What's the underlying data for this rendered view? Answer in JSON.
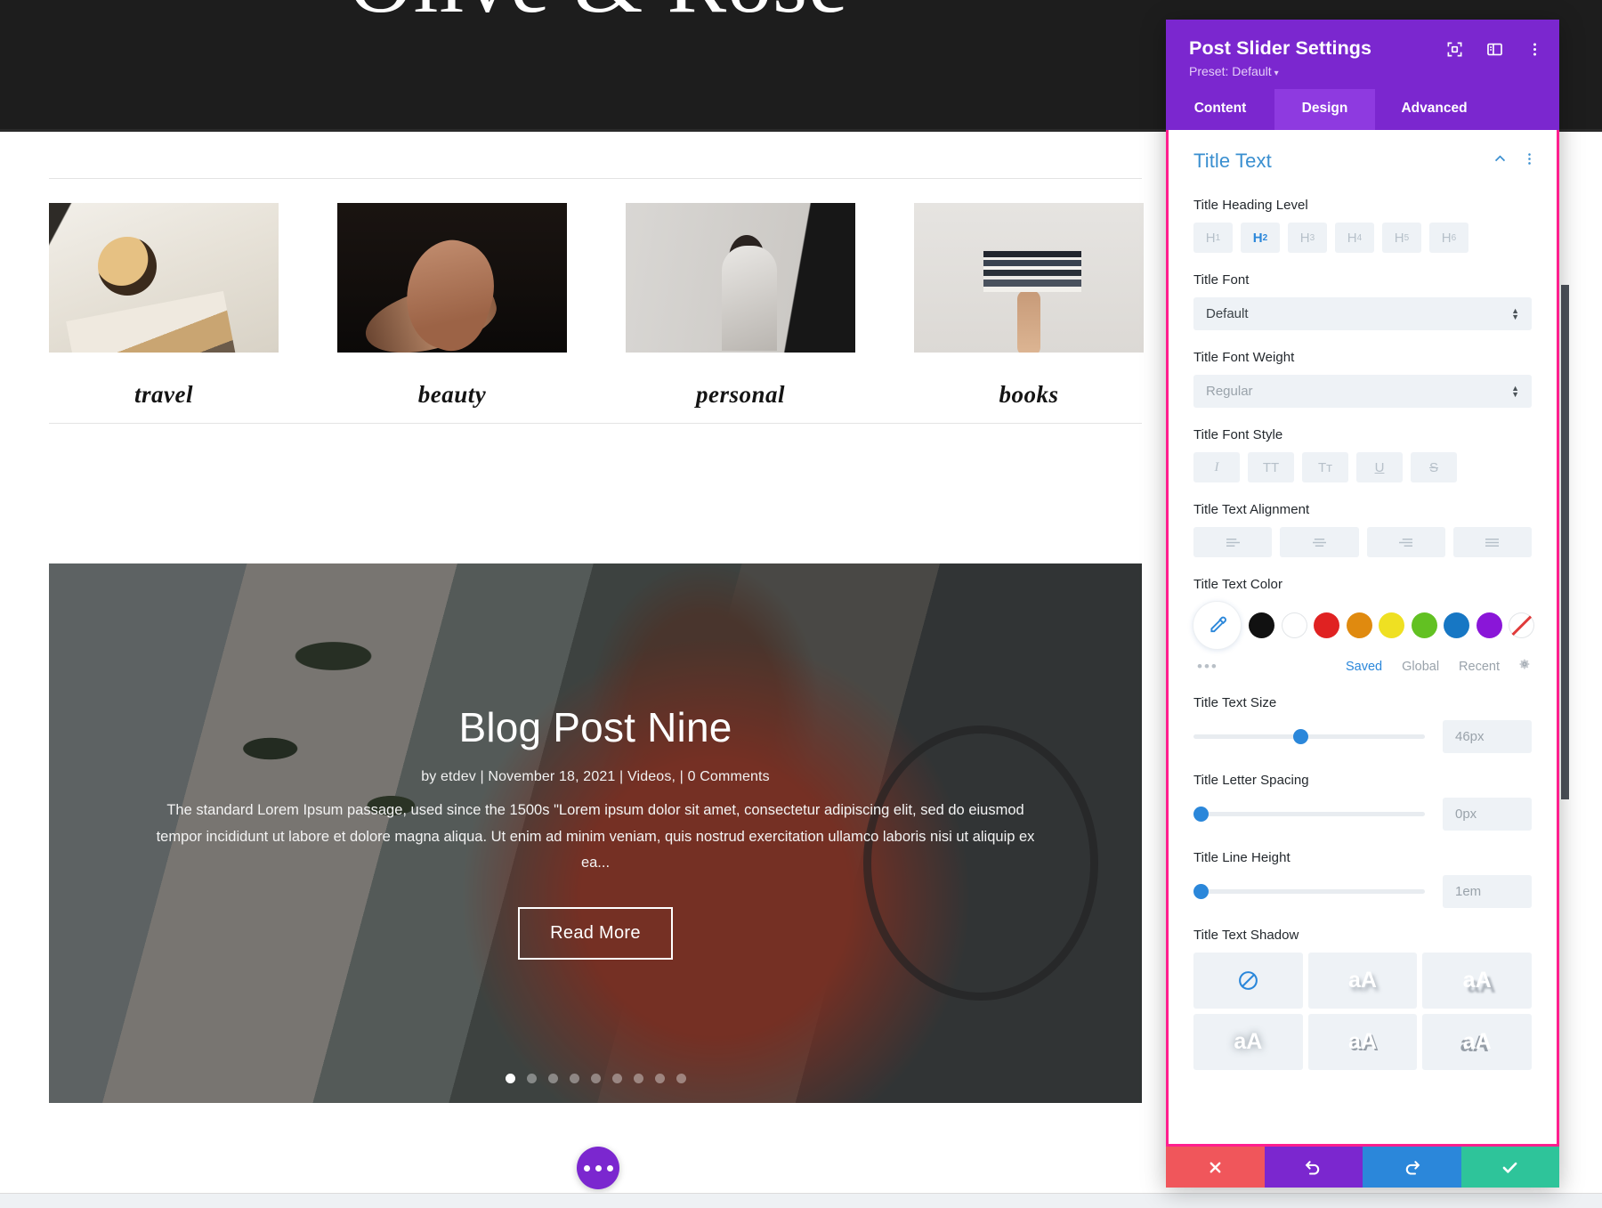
{
  "site": {
    "title": "Olive & Rose",
    "categories": [
      {
        "label": "travel",
        "thumb": "coffee-magazine-photo"
      },
      {
        "label": "beauty",
        "thumb": "hands-dark-photo"
      },
      {
        "label": "personal",
        "thumb": "woman-reading-photo"
      },
      {
        "label": "books",
        "thumb": "hand-holding-books-photo"
      }
    ],
    "slider": {
      "post_title": "Blog Post Nine",
      "meta": "by etdev  |  November 18, 2021  |  Videos,  |  0 Comments",
      "excerpt": "The standard Lorem Ipsum passage, used since the 1500s \"Lorem ipsum dolor sit amet, consectetur adipiscing elit, sed do eiusmod tempor incididunt ut labore et dolore magna aliqua. Ut enim ad minim veniam, quis nostrud exercitation ullamco laboris nisi ut aliquip ex ea...",
      "read_more_label": "Read More",
      "slide_count": 9,
      "active_slide": 1
    },
    "fab": {
      "icon": "ellipsis-icon"
    }
  },
  "modal": {
    "title": "Post Slider Settings",
    "preset_label": "Preset: Default",
    "preset_caret": "▾",
    "header_icons": [
      "expand-icon",
      "layout-panel-icon",
      "more-options-icon"
    ],
    "tabs": [
      {
        "label": "Content",
        "active": false
      },
      {
        "label": "Design",
        "active": true
      },
      {
        "label": "Advanced",
        "active": false
      }
    ],
    "section": {
      "title": "Title Text",
      "collapse_icon": "chevron-up-icon",
      "menu_icon": "more-options-icon"
    },
    "heading_level": {
      "label": "Title Heading Level",
      "options": [
        "H1",
        "H2",
        "H3",
        "H4",
        "H5",
        "H6"
      ],
      "subs": [
        "1",
        "2",
        "3",
        "4",
        "5",
        "6"
      ],
      "active_index": 1
    },
    "font": {
      "label": "Title Font",
      "value": "Default"
    },
    "font_weight": {
      "label": "Title Font Weight",
      "value": "Regular"
    },
    "font_style": {
      "label": "Title Font Style",
      "options": [
        {
          "glyph": "I",
          "name": "italic-button"
        },
        {
          "glyph": "TT",
          "name": "uppercase-button"
        },
        {
          "glyph": "Tт",
          "name": "small-caps-button"
        },
        {
          "glyph": "U",
          "name": "underline-button"
        },
        {
          "glyph": "S",
          "name": "strikethrough-button"
        }
      ]
    },
    "text_alignment": {
      "label": "Title Text Alignment",
      "options": [
        "align-left",
        "align-center",
        "align-right",
        "align-justify"
      ]
    },
    "text_color": {
      "label": "Title Text Color",
      "eyedropper_icon": "eyedropper-icon",
      "swatches": [
        "#111111",
        "#ffffff",
        "#e02222",
        "#e08a0f",
        "#efe022",
        "#62c122",
        "#1777c4",
        "#8a16d8",
        "transparent"
      ],
      "more_icon": "ellipsis-icon",
      "tabs": [
        {
          "label": "Saved",
          "active": true
        },
        {
          "label": "Global",
          "active": false
        },
        {
          "label": "Recent",
          "active": false
        }
      ],
      "settings_icon": "gear-icon"
    },
    "text_size": {
      "label": "Title Text Size",
      "value": "46px",
      "percent": 43
    },
    "letter_spacing": {
      "label": "Title Letter Spacing",
      "value": "0px",
      "percent": 0
    },
    "line_height": {
      "label": "Title Line Height",
      "value": "1em",
      "percent": 0
    },
    "text_shadow": {
      "label": "Title Text Shadow",
      "options": [
        "none",
        "aA",
        "aA",
        "aA",
        "aA",
        "aA"
      ]
    },
    "footer": [
      {
        "name": "cancel-button",
        "icon": "✖"
      },
      {
        "name": "undo-button",
        "icon": "↺"
      },
      {
        "name": "redo-button",
        "icon": "↻"
      },
      {
        "name": "save-button",
        "icon": "✔"
      }
    ],
    "accent_color": "#7b27cf",
    "highlight_border_color": "#ff1f8e"
  }
}
